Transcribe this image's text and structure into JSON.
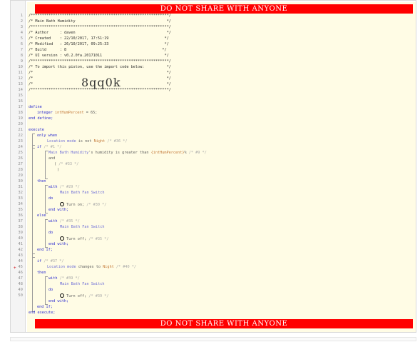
{
  "banner": {
    "top": "DO NOT SHARE WITH ANYONE",
    "bottom": "DO NOT SHARE WITH ANYONE"
  },
  "header": {
    "stars": "/**************************************************************/",
    "title": "/* Main Bath Humidity                                         */",
    "author": "/* Author     : daven                                         */",
    "created": "/* Created    : 22/10/2017, 17:51:19                         */",
    "modified": "/* Modified   : 26/10/2017, 09:25:33                         */",
    "build": "/* Build      : 8                                           */",
    "ui_version": "/* UI version : v0.2.0fa.20171011                            */",
    "import_hint": "/* To import this piston, use the import code below:          */",
    "blank_a": "/*                                                            */",
    "blank_b": "/*                                                            */",
    "blank_c": "/*                                                            */",
    "import_code": "8qq0k"
  },
  "code": {
    "define": "define",
    "decl_kw": "integer",
    "decl_var": "intHumPercent",
    "decl_val": " = 65;",
    "end_define": "end define;",
    "execute": "execute",
    "only_when": "only when",
    "cond1_a": "Location mode",
    "cond1_b": " is not ",
    "cond1_c": "Night",
    "cond1_d": " /* #36 */",
    "if1": "if",
    "if1_c": " /* #1 */",
    "cond2_a": "Main Bath Humidity",
    "cond2_b": "'s humidity is greater than ",
    "cond2_c": "{intHumPercent}",
    "cond2_d": "% ",
    "cond2_e": "/* #9 */",
    "and": "and",
    "paren_open": "( ",
    "paren_c": "/* #33 */",
    "paren_close": ")",
    "then1": "then",
    "with1": "with",
    "with1_c": " /* #29 */",
    "dev1": "Main Bath Fan Switch",
    "do1": "do",
    "turn_on": " Turn on;",
    "turn_on_c": " /* #30 */",
    "end_with1": "end with;",
    "else": "else",
    "with2": "with",
    "with2_c": " /* #35 */",
    "dev2": "Main Bath Fan Switch",
    "do2": "do",
    "turn_off1": " Turn off;",
    "turn_off1_c": " /* #35 */",
    "end_with2": "end with;",
    "end_if1": "end if;",
    "if2": "if",
    "if2_c": " /* #37 */",
    "cond3_a": "Location mode",
    "cond3_b": " changes to ",
    "cond3_c": "Night",
    "cond3_d": " /* #40 */",
    "then2": "then",
    "with3": "with",
    "with3_c": " /* #39 */",
    "dev3": "Main Bath Fan Switch",
    "do3": "do",
    "turn_off2": " Turn off;",
    "turn_off2_c": " /* #39 */",
    "end_with3": "end with;",
    "end_if2": "end if;",
    "end_execute": "end execute;"
  },
  "gutter": {
    "marker": "+"
  },
  "line_numbers": [
    "1",
    "2",
    "3",
    "4",
    "5",
    "6",
    "7",
    "8",
    "9",
    "10",
    "11",
    "12",
    "13",
    "14",
    "15",
    "16",
    "17",
    "18",
    "19",
    "20",
    "21",
    "22",
    "23",
    "24",
    "25",
    "26",
    "27",
    "28",
    "29",
    "30",
    "31",
    "32",
    "33",
    "34",
    "35",
    "36",
    "37",
    "38",
    "39",
    "40",
    "41",
    "42",
    "43",
    "44",
    "45",
    "46",
    "47",
    "48",
    "49",
    "50"
  ]
}
